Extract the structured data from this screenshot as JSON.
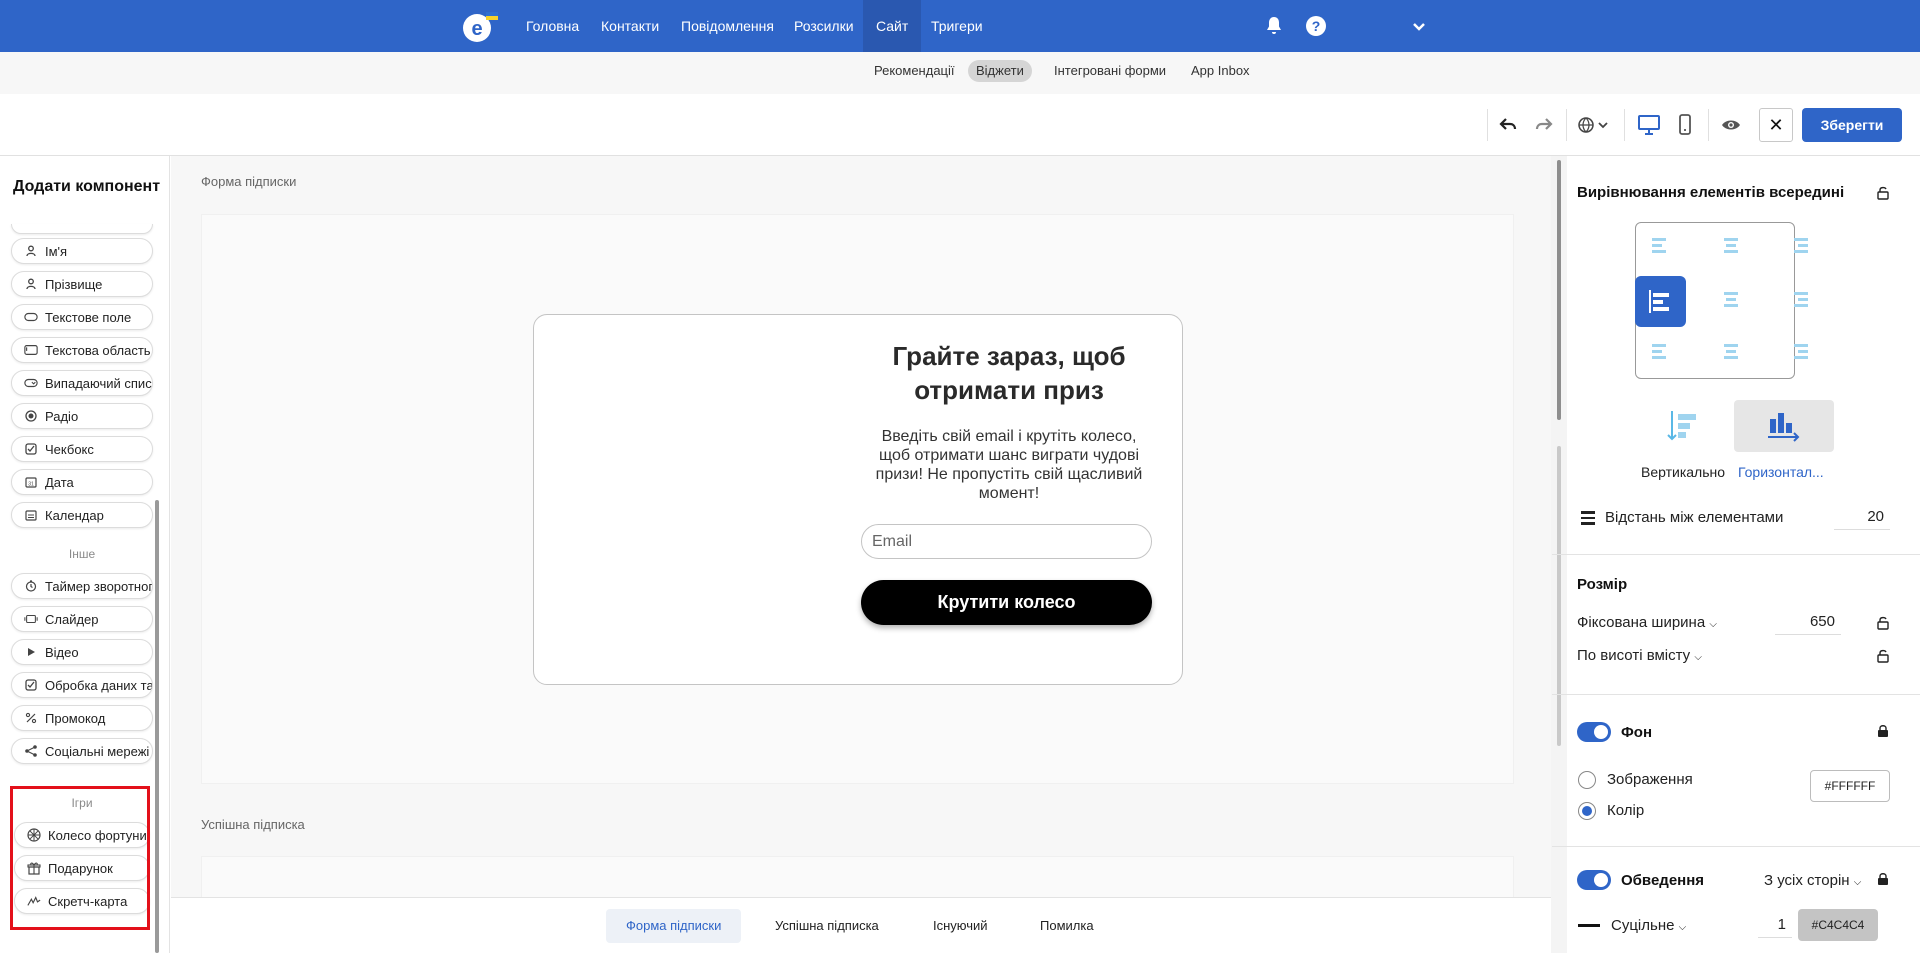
{
  "nav": {
    "items": [
      "Головна",
      "Контакти",
      "Повідомлення",
      "Розсилки",
      "Сайт",
      "Тригери"
    ],
    "active": "Сайт"
  },
  "subnav": {
    "items": [
      "Рекомендації",
      "Віджети",
      "Інтегровані форми",
      "App Inbox"
    ],
    "active": "Віджети"
  },
  "toolbar": {
    "save_label": "Зберегти",
    "close_label": "✕"
  },
  "left": {
    "title": "Додати компонент",
    "fields": [
      {
        "label": "Ім'я",
        "icon": "person-icon"
      },
      {
        "label": "Прізвище",
        "icon": "person-icon"
      },
      {
        "label": "Текстове поле",
        "icon": "text-field-icon"
      },
      {
        "label": "Текстова область",
        "icon": "text-area-icon"
      },
      {
        "label": "Випадаючий список",
        "icon": "dropdown-icon"
      },
      {
        "label": "Радіо",
        "icon": "radio-icon"
      },
      {
        "label": "Чекбокс",
        "icon": "checkbox-icon"
      },
      {
        "label": "Дата",
        "icon": "date-icon"
      },
      {
        "label": "Календар",
        "icon": "calendar-icon"
      }
    ],
    "other_label": "Інше",
    "other": [
      {
        "label": "Таймер зворотного відліку",
        "icon": "timer-icon"
      },
      {
        "label": "Слайдер",
        "icon": "slider-icon"
      },
      {
        "label": "Відео",
        "icon": "play-icon"
      },
      {
        "label": "Обробка даних та",
        "icon": "checkbox-icon"
      },
      {
        "label": "Промокод",
        "icon": "percent-icon"
      },
      {
        "label": "Соціальні мережі",
        "icon": "share-icon"
      }
    ],
    "games_label": "Ігри",
    "games": [
      {
        "label": "Колесо фортуни",
        "icon": "wheel-icon"
      },
      {
        "label": "Подарунок",
        "icon": "gift-icon"
      },
      {
        "label": "Скретч-карта",
        "icon": "scratch-icon"
      }
    ]
  },
  "canvas": {
    "section1": "Форма підписки",
    "section2": "Успішна підписка",
    "form": {
      "title": "Грайте зараз, щоб отримати приз",
      "description": "Введіть свій email і крутіть колесо, щоб отримати шанс виграти чудові призи! Не пропустіть свій щасливий момент!",
      "email_placeholder": "Email",
      "button": "Крутити колесо"
    }
  },
  "bottom_tabs": {
    "items": [
      "Форма підписки",
      "Успішна підписка",
      "Існуючий",
      "Помилка"
    ],
    "active": "Форма підписки"
  },
  "right": {
    "align_title": "Вирівнювання елементів всередині",
    "direction_vertical": "Вертикально",
    "direction_horizontal": "Горизонтал...",
    "spacing_label": "Відстань між елементами",
    "spacing_value": "20",
    "size_title": "Розмір",
    "width_mode": "Фіксована ширина",
    "width_value": "650",
    "height_mode": "По висоті вмісту",
    "bg_title": "Фон",
    "bg_image": "Зображення",
    "bg_color": "Колір",
    "bg_color_value": "#FFFFFF",
    "border_title": "Обведення",
    "border_sides": "З усіх сторін",
    "border_style": "Суцільне",
    "border_width": "1",
    "border_color_value": "#C4C4C4"
  },
  "colors": {
    "brand": "#2f65c8",
    "highlight": "#e3101a"
  }
}
